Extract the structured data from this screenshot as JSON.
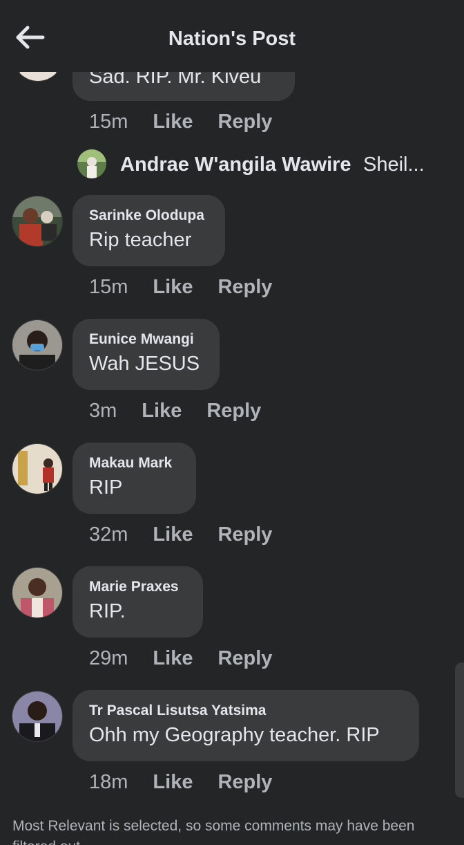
{
  "header": {
    "title": "Nation's Post",
    "back_icon": "arrow-left-icon"
  },
  "partial_comment": {
    "text": "Sad.  RIP. Mr. Kiveu",
    "time": "15m",
    "like": "Like",
    "reply": "Reply"
  },
  "reply_preview": {
    "name": "Andrae W'angila Wawire",
    "snippet": "Sheil..."
  },
  "comments": [
    {
      "name": "Sarinke Olodupa",
      "text": "Rip teacher",
      "time": "15m",
      "like": "Like",
      "reply": "Reply"
    },
    {
      "name": "Eunice Mwangi",
      "text": "Wah JESUS",
      "time": "3m",
      "like": "Like",
      "reply": "Reply"
    },
    {
      "name": "Makau Mark",
      "text": "RIP",
      "time": "32m",
      "like": "Like",
      "reply": "Reply"
    },
    {
      "name": "Marie Praxes",
      "text": "RIP.",
      "time": "29m",
      "like": "Like",
      "reply": "Reply"
    },
    {
      "name": "Tr Pascal Lisutsa Yatsima",
      "text": "Ohh my Geography  teacher. RIP",
      "time": "18m",
      "like": "Like",
      "reply": "Reply"
    }
  ],
  "footer": {
    "note": "Most Relevant is selected, so some comments may have been filtered out."
  },
  "colors": {
    "background": "#242526",
    "bubble": "#3a3b3c",
    "text": "#e4e6eb",
    "muted": "#b0b3b8"
  }
}
